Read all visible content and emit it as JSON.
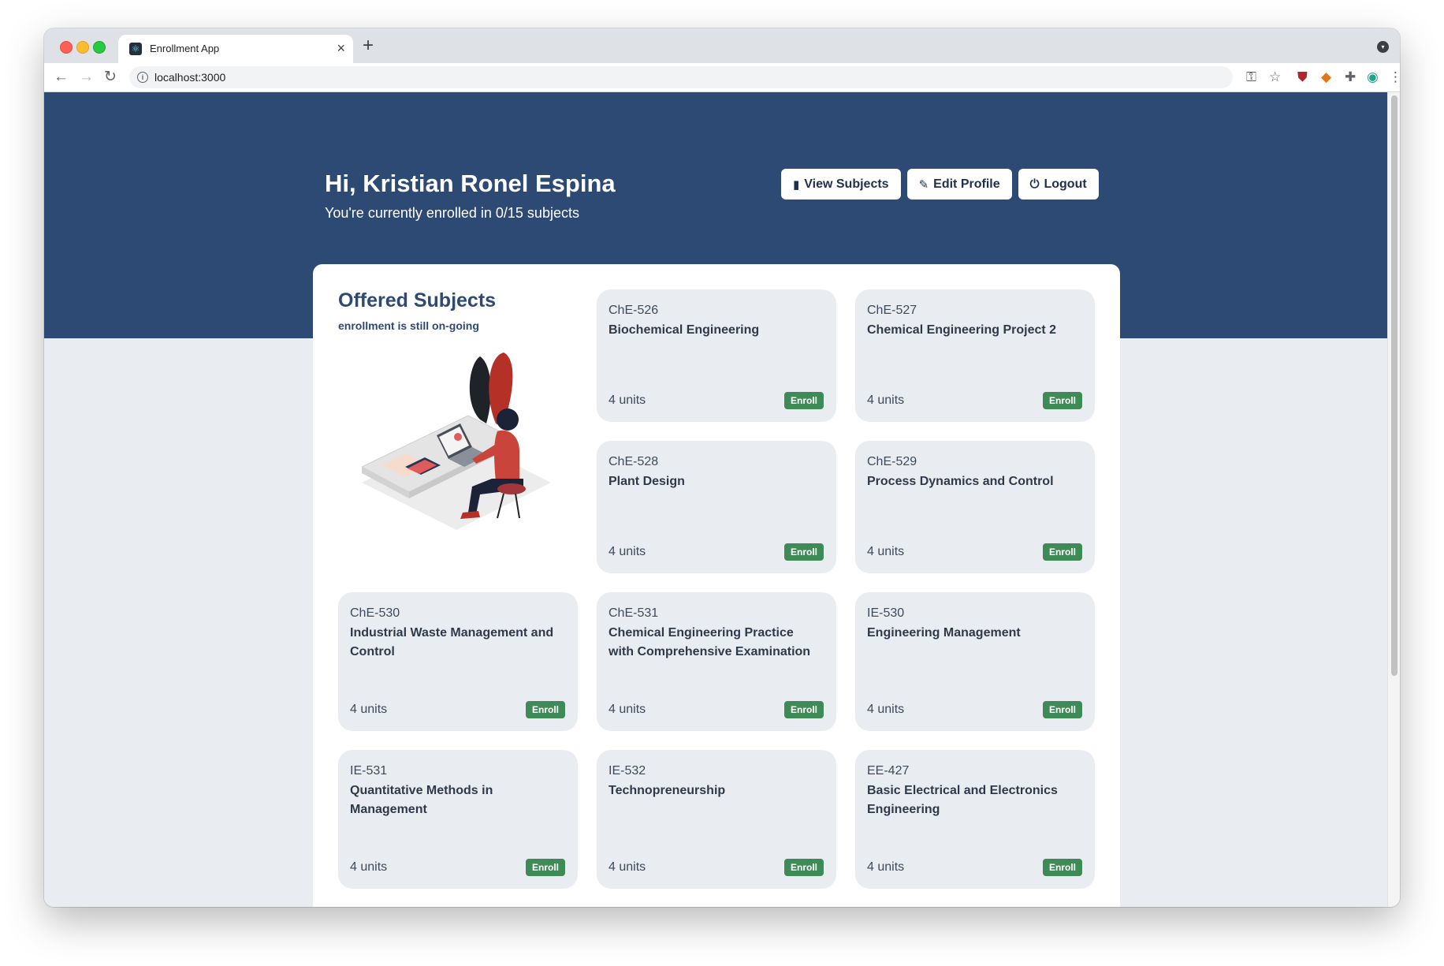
{
  "browser": {
    "tab_title": "Enrollment App",
    "tab_close": "×",
    "new_tab": "+",
    "url": "localhost:3000",
    "info": "i"
  },
  "header": {
    "greeting": "Hi, Kristian Ronel Espina",
    "enrolled_text": "You're currently enrolled in 0/15 subjects",
    "buttons": {
      "view_subjects": "View Subjects",
      "edit_profile": "Edit Profile",
      "logout": "Logout"
    }
  },
  "offered": {
    "title": "Offered Subjects",
    "subtitle": "enrollment is still on-going"
  },
  "subjects": [
    {
      "code": "ChE-526",
      "name": "Biochemical Engineering",
      "units": "4 units",
      "action": "Enroll"
    },
    {
      "code": "ChE-527",
      "name": "Chemical Engineering Project 2",
      "units": "4 units",
      "action": "Enroll"
    },
    {
      "code": "ChE-528",
      "name": "Plant Design",
      "units": "4 units",
      "action": "Enroll"
    },
    {
      "code": "ChE-529",
      "name": "Process Dynamics and Control",
      "units": "4 units",
      "action": "Enroll"
    },
    {
      "code": "ChE-530",
      "name": "Industrial Waste Management and Control",
      "units": "4 units",
      "action": "Enroll"
    },
    {
      "code": "ChE-531",
      "name": "Chemical Engineering Practice with Comprehensive Examination",
      "units": "4 units",
      "action": "Enroll"
    },
    {
      "code": "IE-530",
      "name": "Engineering Management",
      "units": "4 units",
      "action": "Enroll"
    },
    {
      "code": "IE-531",
      "name": "Quantitative Methods in Management",
      "units": "4 units",
      "action": "Enroll"
    },
    {
      "code": "IE-532",
      "name": "Technopreneurship",
      "units": "4 units",
      "action": "Enroll"
    },
    {
      "code": "EE-427",
      "name": "Basic Electrical and Electronics Engineering",
      "units": "4 units",
      "action": "Enroll"
    }
  ],
  "colors": {
    "hero": "#2d4a75",
    "page_background": "#e9edf2",
    "enroll_button": "#3e8b58"
  }
}
